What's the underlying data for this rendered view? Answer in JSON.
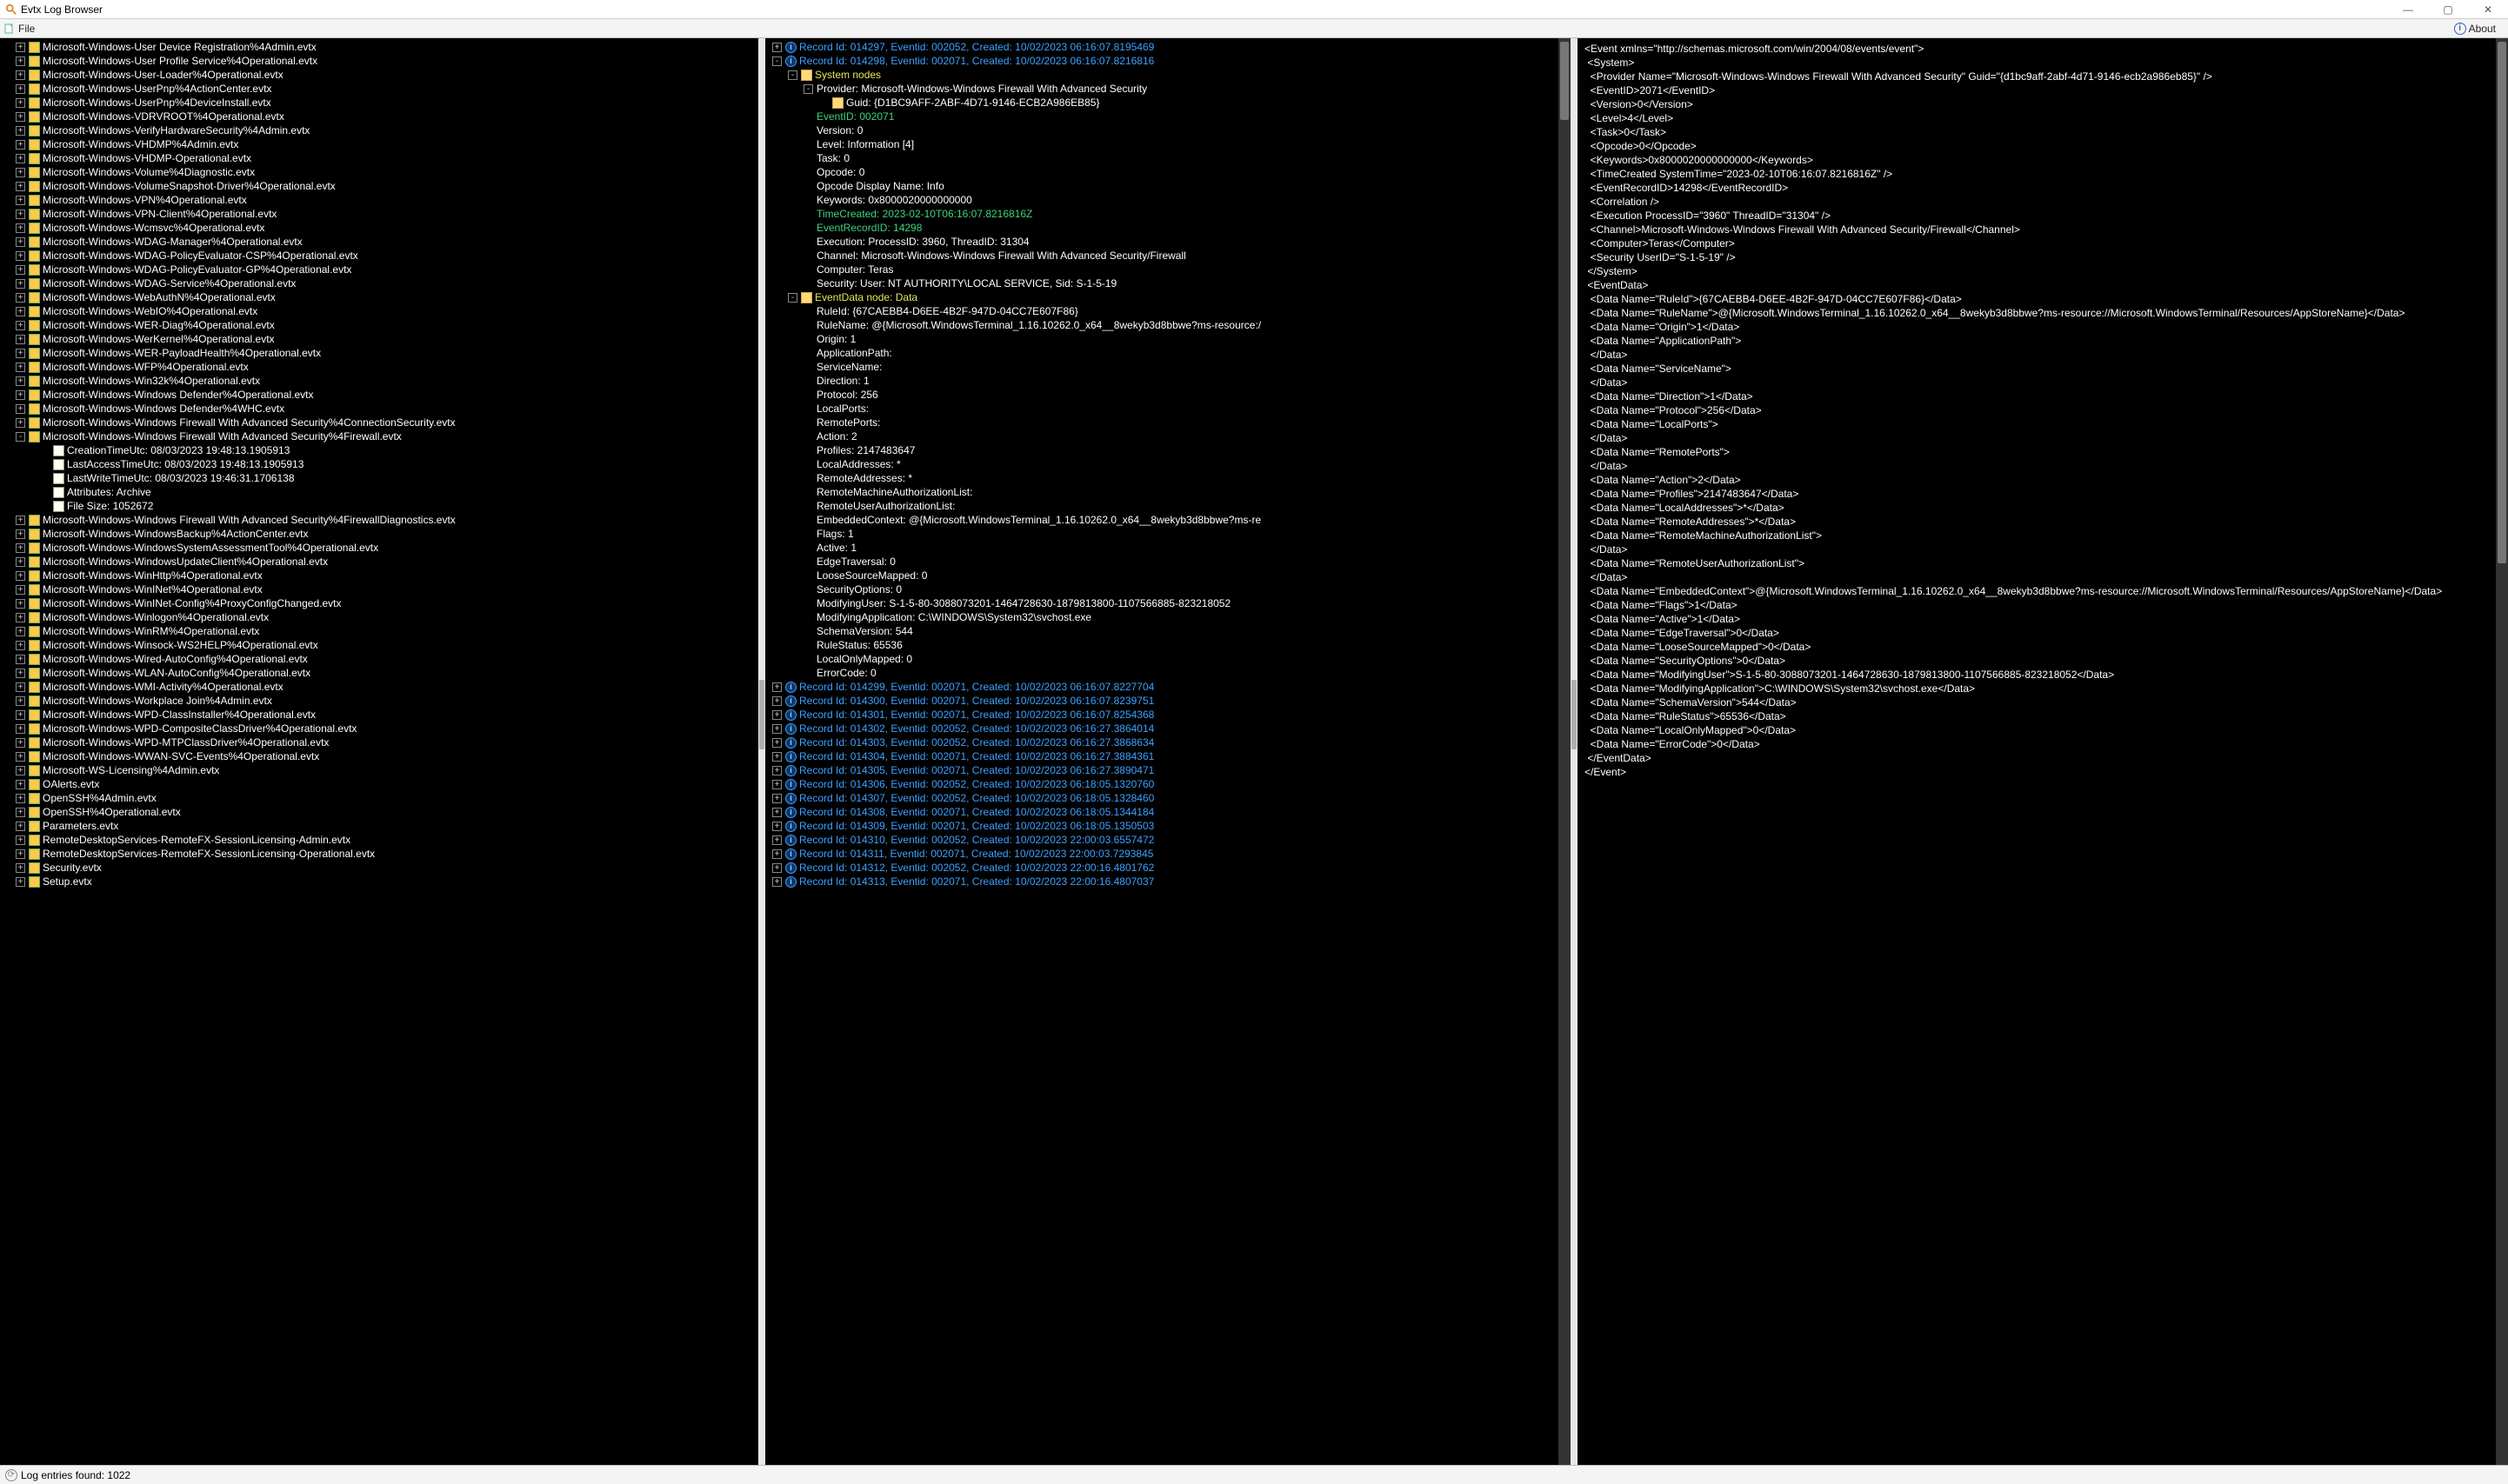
{
  "window": {
    "title": "Evtx Log Browser"
  },
  "menu": {
    "file": "File",
    "about": "About"
  },
  "statusbar": {
    "text": "Log entries found: 1022"
  },
  "left_tree": [
    {
      "exp": "+",
      "lvl": 0,
      "ic": "file",
      "txt": "Microsoft-Windows-User Device Registration%4Admin.evtx"
    },
    {
      "exp": "+",
      "lvl": 0,
      "ic": "file",
      "txt": "Microsoft-Windows-User Profile Service%4Operational.evtx"
    },
    {
      "exp": "+",
      "lvl": 0,
      "ic": "file",
      "txt": "Microsoft-Windows-User-Loader%4Operational.evtx"
    },
    {
      "exp": "+",
      "lvl": 0,
      "ic": "file",
      "txt": "Microsoft-Windows-UserPnp%4ActionCenter.evtx"
    },
    {
      "exp": "+",
      "lvl": 0,
      "ic": "file",
      "txt": "Microsoft-Windows-UserPnp%4DeviceInstall.evtx"
    },
    {
      "exp": "+",
      "lvl": 0,
      "ic": "file",
      "txt": "Microsoft-Windows-VDRVROOT%4Operational.evtx"
    },
    {
      "exp": "+",
      "lvl": 0,
      "ic": "file",
      "txt": "Microsoft-Windows-VerifyHardwareSecurity%4Admin.evtx"
    },
    {
      "exp": "+",
      "lvl": 0,
      "ic": "file",
      "txt": "Microsoft-Windows-VHDMP%4Admin.evtx"
    },
    {
      "exp": "+",
      "lvl": 0,
      "ic": "file",
      "txt": "Microsoft-Windows-VHDMP-Operational.evtx"
    },
    {
      "exp": "+",
      "lvl": 0,
      "ic": "file",
      "txt": "Microsoft-Windows-Volume%4Diagnostic.evtx"
    },
    {
      "exp": "+",
      "lvl": 0,
      "ic": "file",
      "txt": "Microsoft-Windows-VolumeSnapshot-Driver%4Operational.evtx"
    },
    {
      "exp": "+",
      "lvl": 0,
      "ic": "file",
      "txt": "Microsoft-Windows-VPN%4Operational.evtx"
    },
    {
      "exp": "+",
      "lvl": 0,
      "ic": "file",
      "txt": "Microsoft-Windows-VPN-Client%4Operational.evtx"
    },
    {
      "exp": "+",
      "lvl": 0,
      "ic": "file",
      "txt": "Microsoft-Windows-Wcmsvc%4Operational.evtx"
    },
    {
      "exp": "+",
      "lvl": 0,
      "ic": "file",
      "txt": "Microsoft-Windows-WDAG-Manager%4Operational.evtx"
    },
    {
      "exp": "+",
      "lvl": 0,
      "ic": "file",
      "txt": "Microsoft-Windows-WDAG-PolicyEvaluator-CSP%4Operational.evtx"
    },
    {
      "exp": "+",
      "lvl": 0,
      "ic": "file",
      "txt": "Microsoft-Windows-WDAG-PolicyEvaluator-GP%4Operational.evtx"
    },
    {
      "exp": "+",
      "lvl": 0,
      "ic": "file",
      "txt": "Microsoft-Windows-WDAG-Service%4Operational.evtx"
    },
    {
      "exp": "+",
      "lvl": 0,
      "ic": "file",
      "txt": "Microsoft-Windows-WebAuthN%4Operational.evtx"
    },
    {
      "exp": "+",
      "lvl": 0,
      "ic": "file",
      "txt": "Microsoft-Windows-WebIO%4Operational.evtx"
    },
    {
      "exp": "+",
      "lvl": 0,
      "ic": "file",
      "txt": "Microsoft-Windows-WER-Diag%4Operational.evtx"
    },
    {
      "exp": "+",
      "lvl": 0,
      "ic": "file",
      "txt": "Microsoft-Windows-WerKernel%4Operational.evtx"
    },
    {
      "exp": "+",
      "lvl": 0,
      "ic": "file",
      "txt": "Microsoft-Windows-WER-PayloadHealth%4Operational.evtx"
    },
    {
      "exp": "+",
      "lvl": 0,
      "ic": "file",
      "txt": "Microsoft-Windows-WFP%4Operational.evtx"
    },
    {
      "exp": "+",
      "lvl": 0,
      "ic": "file",
      "txt": "Microsoft-Windows-Win32k%4Operational.evtx"
    },
    {
      "exp": "+",
      "lvl": 0,
      "ic": "file",
      "txt": "Microsoft-Windows-Windows Defender%4Operational.evtx"
    },
    {
      "exp": "+",
      "lvl": 0,
      "ic": "file",
      "txt": "Microsoft-Windows-Windows Defender%4WHC.evtx"
    },
    {
      "exp": "+",
      "lvl": 0,
      "ic": "file",
      "txt": "Microsoft-Windows-Windows Firewall With Advanced Security%4ConnectionSecurity.evtx"
    },
    {
      "exp": "-",
      "lvl": 0,
      "ic": "file",
      "txt": "Microsoft-Windows-Windows Firewall With Advanced Security%4Firewall.evtx"
    },
    {
      "lvl": 1,
      "ic": "prop",
      "txt": "CreationTimeUtc: 08/03/2023 19:48:13.1905913"
    },
    {
      "lvl": 1,
      "ic": "prop",
      "txt": "LastAccessTimeUtc: 08/03/2023 19:48:13.1905913"
    },
    {
      "lvl": 1,
      "ic": "prop",
      "txt": "LastWriteTimeUtc: 08/03/2023 19:46:31.1706138"
    },
    {
      "lvl": 1,
      "ic": "prop",
      "txt": "Attributes: Archive"
    },
    {
      "lvl": 1,
      "ic": "prop",
      "txt": "File Size: 1052672"
    },
    {
      "exp": "+",
      "lvl": 0,
      "ic": "file",
      "txt": "Microsoft-Windows-Windows Firewall With Advanced Security%4FirewallDiagnostics.evtx"
    },
    {
      "exp": "+",
      "lvl": 0,
      "ic": "file",
      "txt": "Microsoft-Windows-WindowsBackup%4ActionCenter.evtx"
    },
    {
      "exp": "+",
      "lvl": 0,
      "ic": "file",
      "txt": "Microsoft-Windows-WindowsSystemAssessmentTool%4Operational.evtx"
    },
    {
      "exp": "+",
      "lvl": 0,
      "ic": "file",
      "txt": "Microsoft-Windows-WindowsUpdateClient%4Operational.evtx"
    },
    {
      "exp": "+",
      "lvl": 0,
      "ic": "file",
      "txt": "Microsoft-Windows-WinHttp%4Operational.evtx"
    },
    {
      "exp": "+",
      "lvl": 0,
      "ic": "file",
      "txt": "Microsoft-Windows-WinINet%4Operational.evtx"
    },
    {
      "exp": "+",
      "lvl": 0,
      "ic": "file",
      "txt": "Microsoft-Windows-WinINet-Config%4ProxyConfigChanged.evtx"
    },
    {
      "exp": "+",
      "lvl": 0,
      "ic": "file",
      "txt": "Microsoft-Windows-Winlogon%4Operational.evtx"
    },
    {
      "exp": "+",
      "lvl": 0,
      "ic": "file",
      "txt": "Microsoft-Windows-WinRM%4Operational.evtx"
    },
    {
      "exp": "+",
      "lvl": 0,
      "ic": "file",
      "txt": "Microsoft-Windows-Winsock-WS2HELP%4Operational.evtx"
    },
    {
      "exp": "+",
      "lvl": 0,
      "ic": "file",
      "txt": "Microsoft-Windows-Wired-AutoConfig%4Operational.evtx"
    },
    {
      "exp": "+",
      "lvl": 0,
      "ic": "file",
      "txt": "Microsoft-Windows-WLAN-AutoConfig%4Operational.evtx"
    },
    {
      "exp": "+",
      "lvl": 0,
      "ic": "file",
      "txt": "Microsoft-Windows-WMI-Activity%4Operational.evtx"
    },
    {
      "exp": "+",
      "lvl": 0,
      "ic": "file",
      "txt": "Microsoft-Windows-Workplace Join%4Admin.evtx"
    },
    {
      "exp": "+",
      "lvl": 0,
      "ic": "file",
      "txt": "Microsoft-Windows-WPD-ClassInstaller%4Operational.evtx"
    },
    {
      "exp": "+",
      "lvl": 0,
      "ic": "file",
      "txt": "Microsoft-Windows-WPD-CompositeClassDriver%4Operational.evtx"
    },
    {
      "exp": "+",
      "lvl": 0,
      "ic": "file",
      "txt": "Microsoft-Windows-WPD-MTPClassDriver%4Operational.evtx"
    },
    {
      "exp": "+",
      "lvl": 0,
      "ic": "file",
      "txt": "Microsoft-Windows-WWAN-SVC-Events%4Operational.evtx"
    },
    {
      "exp": "+",
      "lvl": 0,
      "ic": "file",
      "txt": "Microsoft-WS-Licensing%4Admin.evtx"
    },
    {
      "exp": "+",
      "lvl": 0,
      "ic": "file",
      "txt": "OAlerts.evtx"
    },
    {
      "exp": "+",
      "lvl": 0,
      "ic": "file",
      "txt": "OpenSSH%4Admin.evtx"
    },
    {
      "exp": "+",
      "lvl": 0,
      "ic": "file",
      "txt": "OpenSSH%4Operational.evtx"
    },
    {
      "exp": "+",
      "lvl": 0,
      "ic": "file",
      "txt": "Parameters.evtx"
    },
    {
      "exp": "+",
      "lvl": 0,
      "ic": "file",
      "txt": "RemoteDesktopServices-RemoteFX-SessionLicensing-Admin.evtx"
    },
    {
      "exp": "+",
      "lvl": 0,
      "ic": "file",
      "txt": "RemoteDesktopServices-RemoteFX-SessionLicensing-Operational.evtx"
    },
    {
      "exp": "+",
      "lvl": 0,
      "ic": "file",
      "txt": "Security.evtx"
    },
    {
      "exp": "+",
      "lvl": 0,
      "ic": "file",
      "txt": "Setup.evtx"
    }
  ],
  "mid_tree": [
    {
      "exp": "+",
      "lvl": 0,
      "ic": "info",
      "cls": "blue-text",
      "txt": "Record Id: 014297, Eventid: 002052, Created: 10/02/2023 06:16:07.8195469"
    },
    {
      "exp": "-",
      "lvl": 0,
      "ic": "info",
      "cls": "blue-text",
      "txt": "Record Id: 014298, Eventid: 002071, Created: 10/02/2023 06:16:07.8216816"
    },
    {
      "exp": "-",
      "lvl": 1,
      "ic": "folder",
      "cls": "yellow-text",
      "txt": "System nodes"
    },
    {
      "exp": "-",
      "lvl": 2,
      "cls": "white-text",
      "txt": "Provider: Microsoft-Windows-Windows Firewall With Advanced Security"
    },
    {
      "lvl": 3,
      "ic": "folder",
      "cls": "white-text",
      "txt": "Guid: {D1BC9AFF-2ABF-4D71-9146-ECB2A986EB85}"
    },
    {
      "lvl": 2,
      "cls": "green-text",
      "txt": "EventID: 002071"
    },
    {
      "lvl": 2,
      "cls": "white-text",
      "txt": "Version: 0"
    },
    {
      "lvl": 2,
      "cls": "white-text",
      "txt": "Level: Information [4]"
    },
    {
      "lvl": 2,
      "cls": "white-text",
      "txt": "Task: 0"
    },
    {
      "lvl": 2,
      "cls": "white-text",
      "txt": "Opcode: 0"
    },
    {
      "lvl": 2,
      "cls": "white-text",
      "txt": "Opcode Display Name: Info"
    },
    {
      "lvl": 2,
      "cls": "white-text",
      "txt": "Keywords: 0x8000020000000000"
    },
    {
      "lvl": 2,
      "cls": "green-text",
      "txt": "TimeCreated: 2023-02-10T06:16:07.8216816Z"
    },
    {
      "lvl": 2,
      "cls": "green-text",
      "txt": "EventRecordID: 14298"
    },
    {
      "lvl": 2,
      "cls": "white-text",
      "txt": "Execution: ProcessID: 3960, ThreadID: 31304"
    },
    {
      "lvl": 2,
      "cls": "white-text",
      "txt": "Channel: Microsoft-Windows-Windows Firewall With Advanced Security/Firewall"
    },
    {
      "lvl": 2,
      "cls": "white-text",
      "txt": "Computer: Teras"
    },
    {
      "lvl": 2,
      "cls": "white-text",
      "txt": "Security: User: NT AUTHORITY\\LOCAL SERVICE, Sid: S-1-5-19"
    },
    {
      "exp": "-",
      "lvl": 1,
      "ic": "folder",
      "cls": "yellow-text",
      "txt": "EventData node: Data"
    },
    {
      "lvl": 2,
      "cls": "white-text",
      "txt": "RuleId: {67CAEBB4-D6EE-4B2F-947D-04CC7E607F86}"
    },
    {
      "lvl": 2,
      "cls": "white-text",
      "txt": "RuleName: @{Microsoft.WindowsTerminal_1.16.10262.0_x64__8wekyb3d8bbwe?ms-resource:/"
    },
    {
      "lvl": 2,
      "cls": "white-text",
      "txt": "Origin: 1"
    },
    {
      "lvl": 2,
      "cls": "white-text",
      "txt": "ApplicationPath:"
    },
    {
      "lvl": 2,
      "cls": "white-text",
      "txt": "ServiceName:"
    },
    {
      "lvl": 2,
      "cls": "white-text",
      "txt": "Direction: 1"
    },
    {
      "lvl": 2,
      "cls": "white-text",
      "txt": "Protocol: 256"
    },
    {
      "lvl": 2,
      "cls": "white-text",
      "txt": "LocalPorts:"
    },
    {
      "lvl": 2,
      "cls": "white-text",
      "txt": "RemotePorts:"
    },
    {
      "lvl": 2,
      "cls": "white-text",
      "txt": "Action: 2"
    },
    {
      "lvl": 2,
      "cls": "white-text",
      "txt": "Profiles: 2147483647"
    },
    {
      "lvl": 2,
      "cls": "white-text",
      "txt": "LocalAddresses: *"
    },
    {
      "lvl": 2,
      "cls": "white-text",
      "txt": "RemoteAddresses: *"
    },
    {
      "lvl": 2,
      "cls": "white-text",
      "txt": "RemoteMachineAuthorizationList:"
    },
    {
      "lvl": 2,
      "cls": "white-text",
      "txt": "RemoteUserAuthorizationList:"
    },
    {
      "lvl": 2,
      "cls": "white-text",
      "txt": "EmbeddedContext: @{Microsoft.WindowsTerminal_1.16.10262.0_x64__8wekyb3d8bbwe?ms-re"
    },
    {
      "lvl": 2,
      "cls": "white-text",
      "txt": "Flags: 1"
    },
    {
      "lvl": 2,
      "cls": "white-text",
      "txt": "Active: 1"
    },
    {
      "lvl": 2,
      "cls": "white-text",
      "txt": "EdgeTraversal: 0"
    },
    {
      "lvl": 2,
      "cls": "white-text",
      "txt": "LooseSourceMapped: 0"
    },
    {
      "lvl": 2,
      "cls": "white-text",
      "txt": "SecurityOptions: 0"
    },
    {
      "lvl": 2,
      "cls": "white-text",
      "txt": "ModifyingUser: S-1-5-80-3088073201-1464728630-1879813800-1107566885-823218052"
    },
    {
      "lvl": 2,
      "cls": "white-text",
      "txt": "ModifyingApplication: C:\\WINDOWS\\System32\\svchost.exe"
    },
    {
      "lvl": 2,
      "cls": "white-text",
      "txt": "SchemaVersion: 544"
    },
    {
      "lvl": 2,
      "cls": "white-text",
      "txt": "RuleStatus: 65536"
    },
    {
      "lvl": 2,
      "cls": "white-text",
      "txt": "LocalOnlyMapped: 0"
    },
    {
      "lvl": 2,
      "cls": "white-text",
      "txt": "ErrorCode: 0"
    },
    {
      "exp": "+",
      "lvl": 0,
      "ic": "info",
      "cls": "blue-text",
      "txt": "Record Id: 014299, Eventid: 002071, Created: 10/02/2023 06:16:07.8227704"
    },
    {
      "exp": "+",
      "lvl": 0,
      "ic": "info",
      "cls": "blue-text",
      "txt": "Record Id: 014300, Eventid: 002071, Created: 10/02/2023 06:16:07.8239751"
    },
    {
      "exp": "+",
      "lvl": 0,
      "ic": "info",
      "cls": "blue-text",
      "txt": "Record Id: 014301, Eventid: 002071, Created: 10/02/2023 06:16:07.8254368"
    },
    {
      "exp": "+",
      "lvl": 0,
      "ic": "info",
      "cls": "blue-text",
      "txt": "Record Id: 014302, Eventid: 002052, Created: 10/02/2023 06:16:27.3864014"
    },
    {
      "exp": "+",
      "lvl": 0,
      "ic": "info",
      "cls": "blue-text",
      "txt": "Record Id: 014303, Eventid: 002052, Created: 10/02/2023 06:16:27.3868634"
    },
    {
      "exp": "+",
      "lvl": 0,
      "ic": "info",
      "cls": "blue-text",
      "txt": "Record Id: 014304, Eventid: 002071, Created: 10/02/2023 06:16:27.3884361"
    },
    {
      "exp": "+",
      "lvl": 0,
      "ic": "info",
      "cls": "blue-text",
      "txt": "Record Id: 014305, Eventid: 002071, Created: 10/02/2023 06:16:27.3890471"
    },
    {
      "exp": "+",
      "lvl": 0,
      "ic": "info",
      "cls": "blue-text",
      "txt": "Record Id: 014306, Eventid: 002052, Created: 10/02/2023 06:18:05.1320760"
    },
    {
      "exp": "+",
      "lvl": 0,
      "ic": "info",
      "cls": "blue-text",
      "txt": "Record Id: 014307, Eventid: 002052, Created: 10/02/2023 06:18:05.1328460"
    },
    {
      "exp": "+",
      "lvl": 0,
      "ic": "info",
      "cls": "blue-text",
      "txt": "Record Id: 014308, Eventid: 002071, Created: 10/02/2023 06:18:05.1344184"
    },
    {
      "exp": "+",
      "lvl": 0,
      "ic": "info",
      "cls": "blue-text",
      "txt": "Record Id: 014309, Eventid: 002071, Created: 10/02/2023 06:18:05.1350503"
    },
    {
      "exp": "+",
      "lvl": 0,
      "ic": "info",
      "cls": "blue-text",
      "txt": "Record Id: 014310, Eventid: 002052, Created: 10/02/2023 22:00:03.6557472"
    },
    {
      "exp": "+",
      "lvl": 0,
      "ic": "info",
      "cls": "blue-text",
      "txt": "Record Id: 014311, Eventid: 002071, Created: 10/02/2023 22:00:03.7293845"
    },
    {
      "exp": "+",
      "lvl": 0,
      "ic": "info",
      "cls": "blue-text",
      "txt": "Record Id: 014312, Eventid: 002052, Created: 10/02/2023 22:00:16.4801762"
    },
    {
      "exp": "+",
      "lvl": 0,
      "ic": "info",
      "cls": "blue-text",
      "txt": "Record Id: 014313, Eventid: 002071, Created: 10/02/2023 22:00:16.4807037"
    }
  ],
  "xml_lines": [
    "<Event xmlns=\"http://schemas.microsoft.com/win/2004/08/events/event\">",
    " <System>",
    "  <Provider Name=\"Microsoft-Windows-Windows Firewall With Advanced Security\" Guid=\"{d1bc9aff-2abf-4d71-9146-ecb2a986eb85}\" />",
    "  <EventID>2071</EventID>",
    "  <Version>0</Version>",
    "  <Level>4</Level>",
    "  <Task>0</Task>",
    "  <Opcode>0</Opcode>",
    "  <Keywords>0x8000020000000000</Keywords>",
    "  <TimeCreated SystemTime=\"2023-02-10T06:16:07.8216816Z\" />",
    "  <EventRecordID>14298</EventRecordID>",
    "  <Correlation />",
    "  <Execution ProcessID=\"3960\" ThreadID=\"31304\" />",
    "  <Channel>Microsoft-Windows-Windows Firewall With Advanced Security/Firewall</Channel>",
    "  <Computer>Teras</Computer>",
    "  <Security UserID=\"S-1-5-19\" />",
    " </System>",
    " <EventData>",
    "  <Data Name=\"RuleId\">{67CAEBB4-D6EE-4B2F-947D-04CC7E607F86}</Data>",
    "  <Data Name=\"RuleName\">@{Microsoft.WindowsTerminal_1.16.10262.0_x64__8wekyb3d8bbwe?ms-resource://Microsoft.WindowsTerminal/Resources/AppStoreName}</Data>",
    "  <Data Name=\"Origin\">1</Data>",
    "  <Data Name=\"ApplicationPath\">",
    "  </Data>",
    "  <Data Name=\"ServiceName\">",
    "  </Data>",
    "  <Data Name=\"Direction\">1</Data>",
    "  <Data Name=\"Protocol\">256</Data>",
    "  <Data Name=\"LocalPorts\">",
    "  </Data>",
    "  <Data Name=\"RemotePorts\">",
    "  </Data>",
    "  <Data Name=\"Action\">2</Data>",
    "  <Data Name=\"Profiles\">2147483647</Data>",
    "  <Data Name=\"LocalAddresses\">*</Data>",
    "  <Data Name=\"RemoteAddresses\">*</Data>",
    "  <Data Name=\"RemoteMachineAuthorizationList\">",
    "  </Data>",
    "  <Data Name=\"RemoteUserAuthorizationList\">",
    "  </Data>",
    "  <Data Name=\"EmbeddedContext\">@{Microsoft.WindowsTerminal_1.16.10262.0_x64__8wekyb3d8bbwe?ms-resource://Microsoft.WindowsTerminal/Resources/AppStoreName}</Data>",
    "  <Data Name=\"Flags\">1</Data>",
    "  <Data Name=\"Active\">1</Data>",
    "  <Data Name=\"EdgeTraversal\">0</Data>",
    "  <Data Name=\"LooseSourceMapped\">0</Data>",
    "  <Data Name=\"SecurityOptions\">0</Data>",
    "  <Data Name=\"ModifyingUser\">S-1-5-80-3088073201-1464728630-1879813800-1107566885-823218052</Data>",
    "  <Data Name=\"ModifyingApplication\">C:\\WINDOWS\\System32\\svchost.exe</Data>",
    "  <Data Name=\"SchemaVersion\">544</Data>",
    "  <Data Name=\"RuleStatus\">65536</Data>",
    "  <Data Name=\"LocalOnlyMapped\">0</Data>",
    "  <Data Name=\"ErrorCode\">0</Data>",
    " </EventData>",
    "</Event>"
  ]
}
